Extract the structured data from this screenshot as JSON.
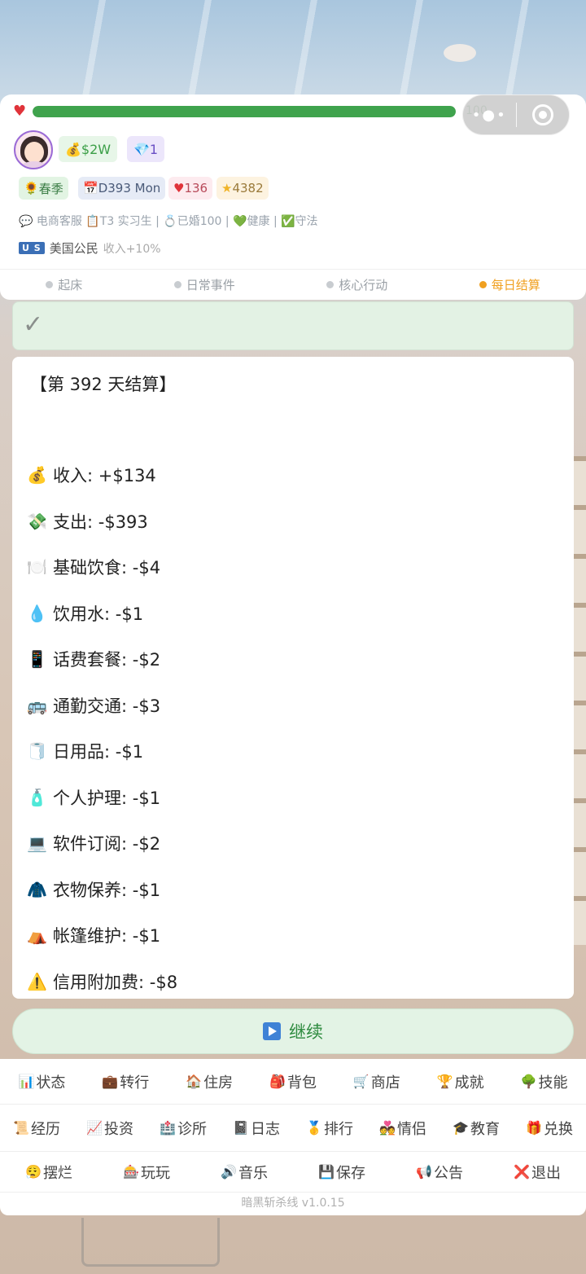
{
  "status": {
    "hp_value": 100,
    "hp_text": "100",
    "money": "$2W",
    "gems": "1",
    "season": "春季",
    "day": "D393 Mon",
    "health": "136",
    "stars": "4382",
    "info_line": "💬 电商客服 📋T3 实习生 | 💍已婚100 | 💚健康 | ✅守法",
    "flag": "U S",
    "nation": "美国公民",
    "bonus": "收入+10%"
  },
  "phases": [
    {
      "label": "起床",
      "active": false
    },
    {
      "label": "日常事件",
      "active": false
    },
    {
      "label": "核心行动",
      "active": false
    },
    {
      "label": "每日结算",
      "active": true
    }
  ],
  "settlement": {
    "title": "【第 392 天结算】",
    "lines": [
      {
        "icon": "💰",
        "text": "收入: +$134"
      },
      {
        "icon": "💸",
        "text": "支出: -$393"
      },
      {
        "icon": "🍽️",
        "text": "基础饮食: -$4"
      },
      {
        "icon": "💧",
        "text": "饮用水: -$1"
      },
      {
        "icon": "📱",
        "text": "话费套餐: -$2"
      },
      {
        "icon": "🚌",
        "text": "通勤交通: -$3"
      },
      {
        "icon": "🧻",
        "text": "日用品: -$1"
      },
      {
        "icon": "🧴",
        "text": "个人护理: -$1"
      },
      {
        "icon": "💻",
        "text": "软件订阅: -$2"
      },
      {
        "icon": "🧥",
        "text": "衣物保养: -$1"
      },
      {
        "icon": "⛺",
        "text": "帐篷维护: -$1"
      },
      {
        "icon": "⚠️",
        "text": "信用附加费: -$8"
      }
    ]
  },
  "continue_label": "继续",
  "menu": {
    "row1": [
      {
        "icon": "📊",
        "label": "状态"
      },
      {
        "icon": "💼",
        "label": "转行"
      },
      {
        "icon": "🏠",
        "label": "住房"
      },
      {
        "icon": "🎒",
        "label": "背包"
      },
      {
        "icon": "🛒",
        "label": "商店"
      },
      {
        "icon": "🏆",
        "label": "成就"
      },
      {
        "icon": "🌳",
        "label": "技能"
      }
    ],
    "row2": [
      {
        "icon": "📜",
        "label": "经历"
      },
      {
        "icon": "📈",
        "label": "投资"
      },
      {
        "icon": "🏥",
        "label": "诊所"
      },
      {
        "icon": "📓",
        "label": "日志"
      },
      {
        "icon": "🥇",
        "label": "排行"
      },
      {
        "icon": "💑",
        "label": "情侣"
      },
      {
        "icon": "🎓",
        "label": "教育"
      },
      {
        "icon": "🎁",
        "label": "兑换"
      }
    ],
    "row3": [
      {
        "icon": "😮‍💨",
        "label": "摆烂"
      },
      {
        "icon": "🎰",
        "label": "玩玩"
      },
      {
        "icon": "🔊",
        "label": "音乐"
      },
      {
        "icon": "💾",
        "label": "保存"
      },
      {
        "icon": "📢",
        "label": "公告"
      },
      {
        "icon": "❌",
        "label": "退出"
      }
    ]
  },
  "version": "暗黑斩杀线 v1.0.15"
}
